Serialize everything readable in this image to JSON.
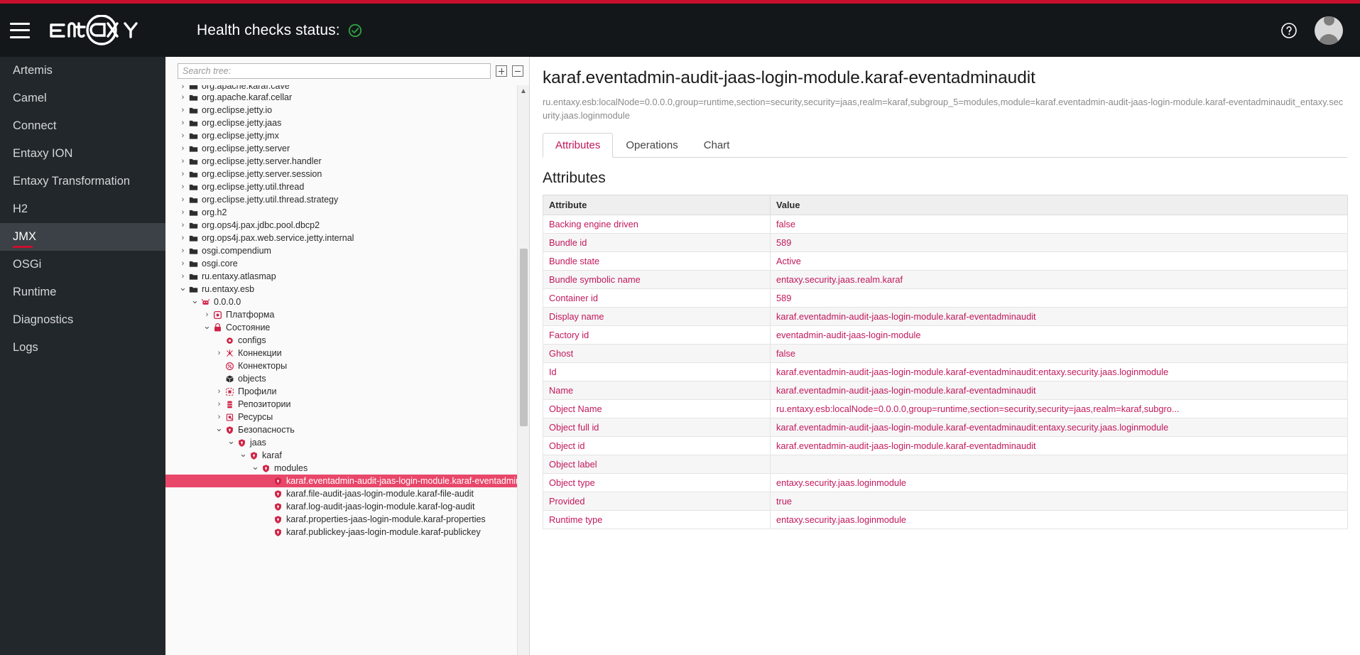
{
  "header": {
    "brand": "ENTAXY",
    "health_label": "Health checks status:",
    "health_icon": "check-circle-icon",
    "menu_icon": "hamburger-icon",
    "help_icon": "help-circle-icon",
    "avatar_icon": "user-avatar-icon"
  },
  "sidebar": {
    "items": [
      {
        "label": "Artemis",
        "active": false
      },
      {
        "label": "Camel",
        "active": false
      },
      {
        "label": "Connect",
        "active": false
      },
      {
        "label": "Entaxy ION",
        "active": false
      },
      {
        "label": "Entaxy Transformation",
        "active": false
      },
      {
        "label": "H2",
        "active": false
      },
      {
        "label": "JMX",
        "active": true
      },
      {
        "label": "OSGi",
        "active": false
      },
      {
        "label": "Runtime",
        "active": false
      },
      {
        "label": "Diagnostics",
        "active": false
      },
      {
        "label": "Logs",
        "active": false
      }
    ]
  },
  "tree": {
    "search_placeholder": "Search tree:",
    "expand_all_label": "expand-all",
    "collapse_all_label": "collapse-all",
    "rows": [
      {
        "label": "org.apache.karaf.cave",
        "indent": 0,
        "arrow": "right",
        "icon": "folder-icon",
        "selected": false,
        "clipped": true
      },
      {
        "label": "org.apache.karaf.cellar",
        "indent": 0,
        "arrow": "right",
        "icon": "folder-icon",
        "selected": false
      },
      {
        "label": "org.eclipse.jetty.io",
        "indent": 0,
        "arrow": "right",
        "icon": "folder-icon",
        "selected": false
      },
      {
        "label": "org.eclipse.jetty.jaas",
        "indent": 0,
        "arrow": "right",
        "icon": "folder-icon",
        "selected": false
      },
      {
        "label": "org.eclipse.jetty.jmx",
        "indent": 0,
        "arrow": "right",
        "icon": "folder-icon",
        "selected": false
      },
      {
        "label": "org.eclipse.jetty.server",
        "indent": 0,
        "arrow": "right",
        "icon": "folder-icon",
        "selected": false
      },
      {
        "label": "org.eclipse.jetty.server.handler",
        "indent": 0,
        "arrow": "right",
        "icon": "folder-icon",
        "selected": false
      },
      {
        "label": "org.eclipse.jetty.server.session",
        "indent": 0,
        "arrow": "right",
        "icon": "folder-icon",
        "selected": false
      },
      {
        "label": "org.eclipse.jetty.util.thread",
        "indent": 0,
        "arrow": "right",
        "icon": "folder-icon",
        "selected": false
      },
      {
        "label": "org.eclipse.jetty.util.thread.strategy",
        "indent": 0,
        "arrow": "right",
        "icon": "folder-icon",
        "selected": false
      },
      {
        "label": "org.h2",
        "indent": 0,
        "arrow": "right",
        "icon": "folder-icon",
        "selected": false
      },
      {
        "label": "org.ops4j.pax.jdbc.pool.dbcp2",
        "indent": 0,
        "arrow": "right",
        "icon": "folder-icon",
        "selected": false
      },
      {
        "label": "org.ops4j.pax.web.service.jetty.internal",
        "indent": 0,
        "arrow": "right",
        "icon": "folder-icon",
        "selected": false
      },
      {
        "label": "osgi.compendium",
        "indent": 0,
        "arrow": "right",
        "icon": "folder-icon",
        "selected": false
      },
      {
        "label": "osgi.core",
        "indent": 0,
        "arrow": "right",
        "icon": "folder-icon",
        "selected": false
      },
      {
        "label": "ru.entaxy.atlasmap",
        "indent": 0,
        "arrow": "right",
        "icon": "folder-icon",
        "selected": false
      },
      {
        "label": "ru.entaxy.esb",
        "indent": 0,
        "arrow": "down",
        "icon": "folder-icon",
        "selected": false
      },
      {
        "label": "0.0.0.0",
        "indent": 1,
        "arrow": "down",
        "icon": "node-icon",
        "selected": false
      },
      {
        "label": "Платформа",
        "indent": 2,
        "arrow": "right",
        "icon": "platform-icon",
        "selected": false
      },
      {
        "label": "Состояние",
        "indent": 2,
        "arrow": "down",
        "icon": "state-icon",
        "selected": false
      },
      {
        "label": "configs",
        "indent": 3,
        "arrow": "none",
        "icon": "config-icon",
        "selected": false
      },
      {
        "label": "Коннекции",
        "indent": 3,
        "arrow": "right",
        "icon": "connection-icon",
        "selected": false
      },
      {
        "label": "Коннекторы",
        "indent": 3,
        "arrow": "none",
        "icon": "connector-icon",
        "selected": false
      },
      {
        "label": "objects",
        "indent": 3,
        "arrow": "none",
        "icon": "cube-icon",
        "selected": false
      },
      {
        "label": "Профили",
        "indent": 3,
        "arrow": "right",
        "icon": "profile-icon",
        "selected": false
      },
      {
        "label": "Репозитории",
        "indent": 3,
        "arrow": "right",
        "icon": "repository-icon",
        "selected": false
      },
      {
        "label": "Ресурсы",
        "indent": 3,
        "arrow": "right",
        "icon": "resource-icon",
        "selected": false
      },
      {
        "label": "Безопасность",
        "indent": 3,
        "arrow": "down",
        "icon": "shield-icon",
        "selected": false
      },
      {
        "label": "jaas",
        "indent": 4,
        "arrow": "down",
        "icon": "shield-icon",
        "selected": false
      },
      {
        "label": "karaf",
        "indent": 5,
        "arrow": "down",
        "icon": "shield-icon",
        "selected": false
      },
      {
        "label": "modules",
        "indent": 6,
        "arrow": "down",
        "icon": "shield-icon",
        "selected": false
      },
      {
        "label": "karaf.eventadmin-audit-jaas-login-module.karaf-eventadminaudit",
        "indent": 7,
        "arrow": "none",
        "icon": "shield-icon",
        "selected": true,
        "trailing": "›"
      },
      {
        "label": "karaf.file-audit-jaas-login-module.karaf-file-audit",
        "indent": 7,
        "arrow": "none",
        "icon": "shield-icon",
        "selected": false
      },
      {
        "label": "karaf.log-audit-jaas-login-module.karaf-log-audit",
        "indent": 7,
        "arrow": "none",
        "icon": "shield-icon",
        "selected": false
      },
      {
        "label": "karaf.properties-jaas-login-module.karaf-properties",
        "indent": 7,
        "arrow": "none",
        "icon": "shield-icon",
        "selected": false
      },
      {
        "label": "karaf.publickey-jaas-login-module.karaf-publickey",
        "indent": 7,
        "arrow": "none",
        "icon": "shield-icon",
        "selected": false
      }
    ]
  },
  "main": {
    "title": "karaf.eventadmin-audit-jaas-login-module.karaf-eventadminaudit",
    "object_name": "ru.entaxy.esb:localNode=0.0.0.0,group=runtime,section=security,security=jaas,realm=karaf,subgroup_5=modules,module=karaf.eventadmin-audit-jaas-login-module.karaf-eventadminaudit_entaxy.security.jaas.loginmodule",
    "tabs": [
      {
        "label": "Attributes",
        "active": true
      },
      {
        "label": "Operations",
        "active": false
      },
      {
        "label": "Chart",
        "active": false
      }
    ],
    "attributes_heading": "Attributes",
    "table": {
      "columns": [
        "Attribute",
        "Value"
      ],
      "rows": [
        [
          "Backing engine driven",
          "false"
        ],
        [
          "Bundle id",
          "589"
        ],
        [
          "Bundle state",
          "Active"
        ],
        [
          "Bundle symbolic name",
          "entaxy.security.jaas.realm.karaf"
        ],
        [
          "Container id",
          "589"
        ],
        [
          "Display name",
          "karaf.eventadmin-audit-jaas-login-module.karaf-eventadminaudit"
        ],
        [
          "Factory id",
          "eventadmin-audit-jaas-login-module"
        ],
        [
          "Ghost",
          "false"
        ],
        [
          "Id",
          "karaf.eventadmin-audit-jaas-login-module.karaf-eventadminaudit:entaxy.security.jaas.loginmodule"
        ],
        [
          "Name",
          "karaf.eventadmin-audit-jaas-login-module.karaf-eventadminaudit"
        ],
        [
          "Object Name",
          "ru.entaxy.esb:localNode=0.0.0.0,group=runtime,section=security,security=jaas,realm=karaf,subgro..."
        ],
        [
          "Object full id",
          "karaf.eventadmin-audit-jaas-login-module.karaf-eventadminaudit:entaxy.security.jaas.loginmodule"
        ],
        [
          "Object id",
          "karaf.eventadmin-audit-jaas-login-module.karaf-eventadminaudit"
        ],
        [
          "Object label",
          ""
        ],
        [
          "Object type",
          "entaxy.security.jaas.loginmodule"
        ],
        [
          "Provided",
          "true"
        ],
        [
          "Runtime type",
          "entaxy.security.jaas.loginmodule"
        ]
      ]
    }
  },
  "colors": {
    "accent_red": "#c8102e",
    "header_bg": "#13171a",
    "sidebar_bg": "#22272b",
    "link_pink": "#c2185b",
    "selection_pink": "#e8476a",
    "health_green": "#2e9e3e"
  }
}
